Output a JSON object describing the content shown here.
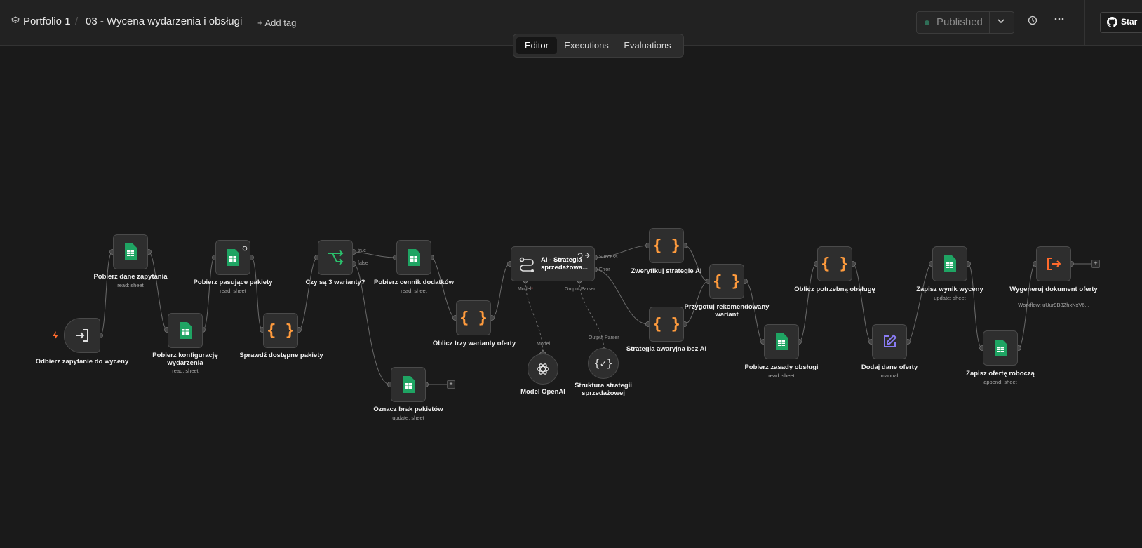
{
  "header": {
    "project": "Portfolio 1",
    "workflow_name": "03 - Wycena wydarzenia i obsługi",
    "add_tag": "+ Add tag",
    "tabs": [
      "Editor",
      "Executions",
      "Evaluations"
    ],
    "active_tab": "Editor",
    "published_label": "Published",
    "star_label": "Star",
    "icons": [
      "layers-icon",
      "chevron-down-icon",
      "history-icon",
      "more-icon",
      "github-icon"
    ]
  },
  "nodes": {
    "trigger": {
      "label": "Odbierz zapytanie do wyceny",
      "icon": "enter-icon"
    },
    "get_request": {
      "label": "Pobierz dane zapytania",
      "sub": "read: sheet",
      "icon": "sheets-icon"
    },
    "get_config": {
      "label": "Pobierz konfigurację wydarzenia",
      "sub": "read: sheet",
      "icon": "sheets-icon"
    },
    "get_packages": {
      "label": "Pobierz pasujące pakiety",
      "sub": "read: sheet",
      "icon": "sheets-icon"
    },
    "check_packages": {
      "label": "Sprawdź dostępne pakiety",
      "icon": "code-icon"
    },
    "if_three": {
      "label": "Czy są 3 warianty?",
      "icon": "if-icon",
      "true_label": "true",
      "false_label": "false"
    },
    "get_pricelist": {
      "label": "Pobierz cennik dodatków",
      "sub": "read: sheet",
      "icon": "sheets-icon"
    },
    "mark_no_packages": {
      "label": "Oznacz brak pakietów",
      "sub": "update: sheet",
      "icon": "sheets-icon"
    },
    "calc_variants": {
      "label": "Oblicz trzy warianty oferty",
      "icon": "code-icon"
    },
    "ai_strategy": {
      "label": "AI - Strategia sprzedażowa...",
      "success_label": "Success",
      "error_label": "Error",
      "model_label": "Model",
      "parser_label": "Output Parser"
    },
    "model_openai": {
      "label": "Model OpenAI",
      "top_label": "Model",
      "icon": "openai-icon"
    },
    "output_parser": {
      "label": "Struktura strategii sprzedażowej",
      "top_label": "Output Parser",
      "icon": "braces-icon"
    },
    "verify_strategy": {
      "label": "Zweryfikuj strategię AI",
      "icon": "code-icon"
    },
    "fallback_strategy": {
      "label": "Strategia awaryjna bez AI",
      "icon": "code-icon"
    },
    "prepare_variant": {
      "label": "Przygotuj rekomendowany wariant",
      "icon": "code-icon"
    },
    "get_service_rules": {
      "label": "Pobierz zasady obsługi",
      "sub": "read: sheet",
      "icon": "sheets-icon"
    },
    "calc_service": {
      "label": "Oblicz potrzebną obsługę",
      "icon": "code-icon"
    },
    "add_offer_data": {
      "label": "Dodaj dane oferty",
      "sub": "manual",
      "icon": "edit-icon"
    },
    "save_result": {
      "label": "Zapisz wynik wyceny",
      "sub": "update: sheet",
      "icon": "sheets-icon"
    },
    "save_draft": {
      "label": "Zapisz ofertę roboczą",
      "sub": "append: sheet",
      "icon": "sheets-icon"
    },
    "generate_doc": {
      "label": "Wygeneruj dokument oferty",
      "sub": "Workflow: uUur9B8ZhxNxV6...",
      "icon": "execute-workflow-icon"
    }
  },
  "colors": {
    "background": "#1a1a1a",
    "node": "#2e2e2e",
    "sheets": "#1fa463",
    "code": "#ff9b3d",
    "if": "#2bbf6c",
    "exec": "#ff6a2c",
    "edit": "#8a7cf5"
  }
}
